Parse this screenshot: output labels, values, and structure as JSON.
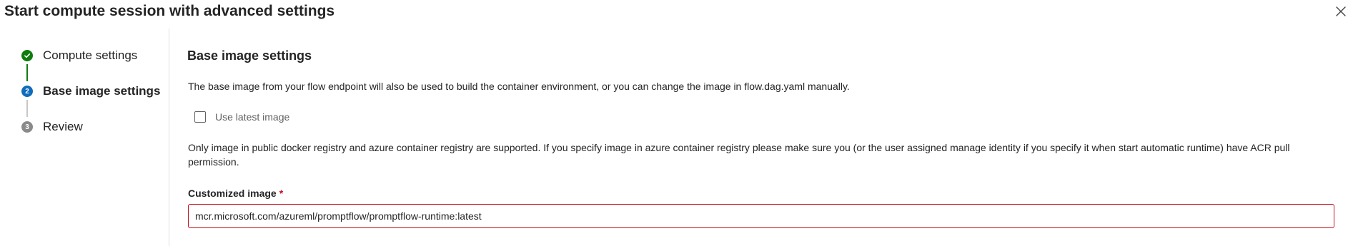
{
  "dialog": {
    "title": "Start compute session with advanced settings"
  },
  "steps": [
    {
      "number": "1",
      "label": "Compute settings",
      "state": "completed"
    },
    {
      "number": "2",
      "label": "Base image settings",
      "state": "current"
    },
    {
      "number": "3",
      "label": "Review",
      "state": "pending"
    }
  ],
  "base_image": {
    "heading": "Base image settings",
    "description": "The base image from your flow endpoint will also be used to build the container environment, or you can change the image in flow.dag.yaml manually.",
    "use_latest_label": "Use latest image",
    "use_latest_checked": false,
    "note": "Only image in public docker registry and azure container registry are supported. If you specify image in azure container registry please make sure you (or the user assigned manage identity if you specify it when start automatic runtime) have ACR pull permission.",
    "customized_image_label": "Customized image",
    "required_mark": "*",
    "customized_image_value": "mcr.microsoft.com/azureml/promptflow/promptflow-runtime:latest"
  },
  "colors": {
    "step_completed": "#107c10",
    "step_current": "#0f6cbd",
    "step_pending": "#8a8a8a",
    "error_border": "#c50f1f"
  },
  "icons": {
    "close": "close-icon",
    "check": "checkmark-icon"
  }
}
